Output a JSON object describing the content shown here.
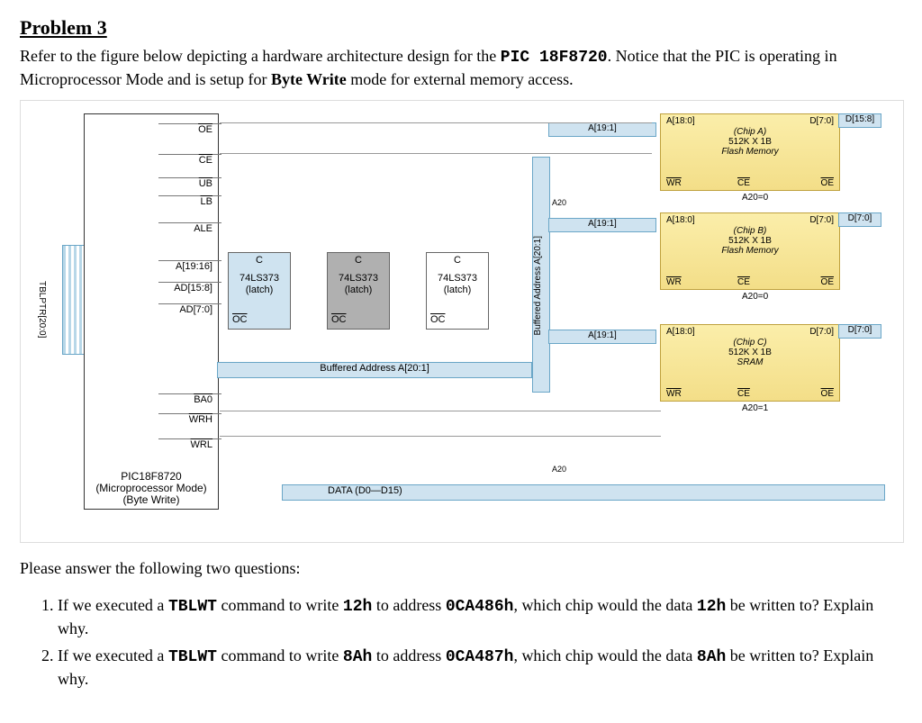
{
  "title": "Problem 3",
  "intro_parts": {
    "a": "Refer to the figure below depicting a hardware architecture design for the ",
    "b": "PIC 18F8720",
    "c": ". Notice that the PIC is operating in Microprocessor Mode and is setup for ",
    "d": "Byte Write",
    "e": " mode for external memory access."
  },
  "tblptr": "TBLPTR[20:0]",
  "pins": {
    "oe": "OE",
    "ce": "CE",
    "ub": "UB",
    "lb": "LB",
    "ale": "ALE",
    "a19_16": "A[19:16]",
    "ad15_8": "AD[15:8]",
    "ad7_0": "AD[7:0]",
    "ba0": "BA0",
    "wrh": "WRH",
    "wrl": "WRL"
  },
  "pic_text_lines": {
    "l1": "PIC18F8720",
    "l2": "(Microprocessor Mode)",
    "l3": "(Byte Write)"
  },
  "latch": {
    "c": "C",
    "name": "74LS373",
    "sub": "(latch)",
    "oc": "OC"
  },
  "buf_bus": "Buffered Address A[20:1]",
  "vbuf": "Buffered Address A[20:1]",
  "abus": "A[19:1]",
  "a20": "A20",
  "chips": [
    {
      "addr": "A[18:0]",
      "dpin": "D[7:0]",
      "name": "(Chip A)",
      "size": "512K X 1B",
      "type": "Flash Memory",
      "wr": "WR",
      "ce": "CE",
      "oe": "OE",
      "note": "A20=0",
      "dbus": "D[15:8]"
    },
    {
      "addr": "A[18:0]",
      "dpin": "D[7:0]",
      "name": "(Chip B)",
      "size": "512K X 1B",
      "type": "Flash Memory",
      "wr": "WR",
      "ce": "CE",
      "oe": "OE",
      "note": "A20=0",
      "dbus": "D[7:0]"
    },
    {
      "addr": "A[18:0]",
      "dpin": "D[7:0]",
      "name": "(Chip C)",
      "size": "512K X 1B",
      "type": "SRAM",
      "wr": "WR",
      "ce": "CE",
      "oe": "OE",
      "note": "A20=1",
      "dbus": "D[7:0]"
    }
  ],
  "data_bus": "DATA (D0—D15)",
  "followup": "Please answer the following two questions:",
  "q1": {
    "a": "If we executed a ",
    "b": "TBLWT",
    "c": " command to write ",
    "d": "12h",
    "e": " to address ",
    "f": "0CA486h",
    "g": ", which chip would the data ",
    "h": "12h",
    "i": " be written to? Explain why."
  },
  "q2": {
    "a": "If we executed a ",
    "b": "TBLWT",
    "c": " command to write ",
    "d": "8Ah",
    "e": " to address ",
    "f": "0CA487h",
    "g": ", which chip would the data ",
    "h": "8Ah",
    "i": " be written to? Explain why."
  }
}
